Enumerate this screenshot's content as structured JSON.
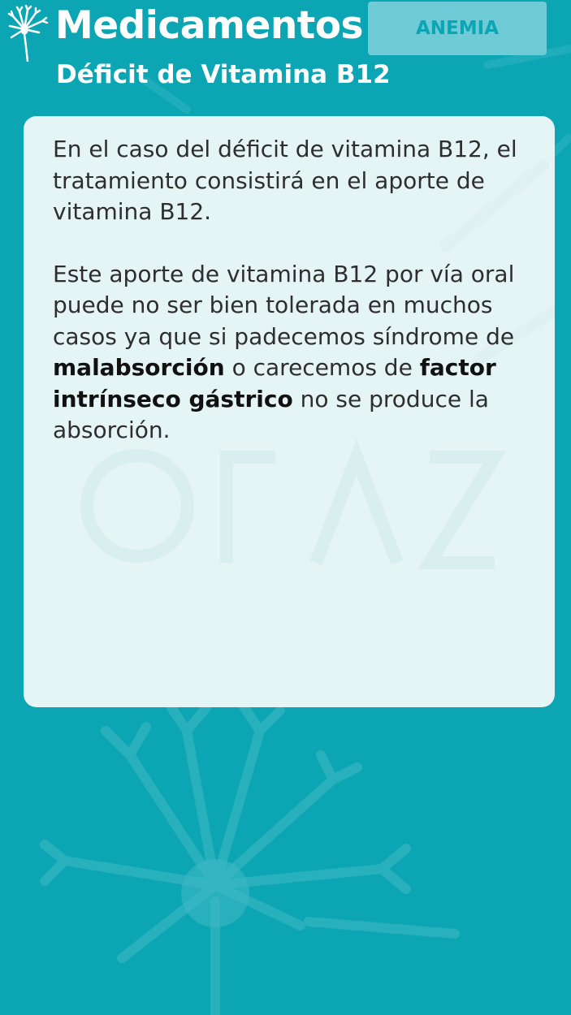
{
  "header": {
    "title": "Medicamentos",
    "subtitle": "Déficit de Vitamina B12",
    "tag_label": "ANEMIA",
    "logo_icon": "dandelion-icon"
  },
  "content": {
    "paragraph1": "En el caso del déficit de vitamina B12, el tratamiento consistirá en el aporte de vitamina B12.",
    "paragraph2": {
      "part1": "Este aporte de vitamina B12 por vía oral puede no ser bien tolerada en muchos casos ya que si padecemos síndrome de ",
      "bold1": "malabsorción",
      "part2": " o carecemos de ",
      "bold2": "factor intrínseco gástrico",
      "part3": " no se produce la absorción."
    }
  },
  "colors": {
    "background": "#0ca5b4",
    "card_background": "#e5f4f4",
    "tag_background": "#6fcbd6",
    "tag_text": "#0ca5b4",
    "text": "#2e2e2e"
  },
  "decorations": {
    "background_icon": "dandelion-watermark-icon"
  }
}
